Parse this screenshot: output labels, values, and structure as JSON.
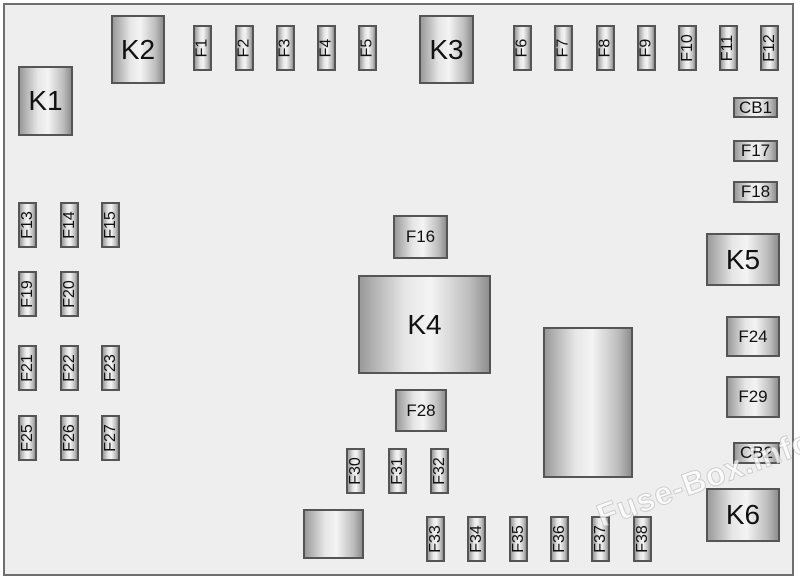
{
  "diagram": {
    "components": [
      {
        "id": "K1",
        "label": "K1",
        "kind": "relay"
      },
      {
        "id": "K2",
        "label": "K2",
        "kind": "relay"
      },
      {
        "id": "K3",
        "label": "K3",
        "kind": "relay"
      },
      {
        "id": "K4",
        "label": "K4",
        "kind": "relay"
      },
      {
        "id": "K5",
        "label": "K5",
        "kind": "relay"
      },
      {
        "id": "K6",
        "label": "K6",
        "kind": "relay"
      },
      {
        "id": "F1",
        "label": "F1",
        "kind": "mini-fuse"
      },
      {
        "id": "F2",
        "label": "F2",
        "kind": "mini-fuse"
      },
      {
        "id": "F3",
        "label": "F3",
        "kind": "mini-fuse"
      },
      {
        "id": "F4",
        "label": "F4",
        "kind": "mini-fuse"
      },
      {
        "id": "F5",
        "label": "F5",
        "kind": "mini-fuse"
      },
      {
        "id": "F6",
        "label": "F6",
        "kind": "mini-fuse"
      },
      {
        "id": "F7",
        "label": "F7",
        "kind": "mini-fuse"
      },
      {
        "id": "F8",
        "label": "F8",
        "kind": "mini-fuse"
      },
      {
        "id": "F9",
        "label": "F9",
        "kind": "mini-fuse"
      },
      {
        "id": "F10",
        "label": "F10",
        "kind": "mini-fuse"
      },
      {
        "id": "F11",
        "label": "F11",
        "kind": "mini-fuse"
      },
      {
        "id": "F12",
        "label": "F12",
        "kind": "mini-fuse"
      },
      {
        "id": "CB1",
        "label": "CB1",
        "kind": "circuit-breaker"
      },
      {
        "id": "F17",
        "label": "F17",
        "kind": "fuse"
      },
      {
        "id": "F18",
        "label": "F18",
        "kind": "fuse"
      },
      {
        "id": "F13",
        "label": "F13",
        "kind": "mini-fuse"
      },
      {
        "id": "F14",
        "label": "F14",
        "kind": "mini-fuse"
      },
      {
        "id": "F15",
        "label": "F15",
        "kind": "mini-fuse"
      },
      {
        "id": "F16",
        "label": "F16",
        "kind": "cartridge-fuse"
      },
      {
        "id": "F19",
        "label": "F19",
        "kind": "mini-fuse"
      },
      {
        "id": "F20",
        "label": "F20",
        "kind": "mini-fuse"
      },
      {
        "id": "F21",
        "label": "F21",
        "kind": "mini-fuse"
      },
      {
        "id": "F22",
        "label": "F22",
        "kind": "mini-fuse"
      },
      {
        "id": "F23",
        "label": "F23",
        "kind": "mini-fuse"
      },
      {
        "id": "F24",
        "label": "F24",
        "kind": "cartridge-fuse"
      },
      {
        "id": "F25",
        "label": "F25",
        "kind": "mini-fuse"
      },
      {
        "id": "F26",
        "label": "F26",
        "kind": "mini-fuse"
      },
      {
        "id": "F27",
        "label": "F27",
        "kind": "mini-fuse"
      },
      {
        "id": "F28",
        "label": "F28",
        "kind": "cartridge-fuse"
      },
      {
        "id": "F29",
        "label": "F29",
        "kind": "cartridge-fuse"
      },
      {
        "id": "CB2",
        "label": "CB2",
        "kind": "circuit-breaker"
      },
      {
        "id": "F30",
        "label": "F30",
        "kind": "mini-fuse"
      },
      {
        "id": "F31",
        "label": "F31",
        "kind": "mini-fuse"
      },
      {
        "id": "F32",
        "label": "F32",
        "kind": "mini-fuse"
      },
      {
        "id": "F33",
        "label": "F33",
        "kind": "mini-fuse"
      },
      {
        "id": "F34",
        "label": "F34",
        "kind": "mini-fuse"
      },
      {
        "id": "F35",
        "label": "F35",
        "kind": "mini-fuse"
      },
      {
        "id": "F36",
        "label": "F36",
        "kind": "mini-fuse"
      },
      {
        "id": "F37",
        "label": "F37",
        "kind": "mini-fuse"
      },
      {
        "id": "F38",
        "label": "F38",
        "kind": "mini-fuse"
      },
      {
        "id": "blank-large",
        "label": "",
        "kind": "unlabeled-block"
      },
      {
        "id": "blank-small",
        "label": "",
        "kind": "unlabeled-block"
      }
    ],
    "watermark": "Fuse-Box.info"
  }
}
